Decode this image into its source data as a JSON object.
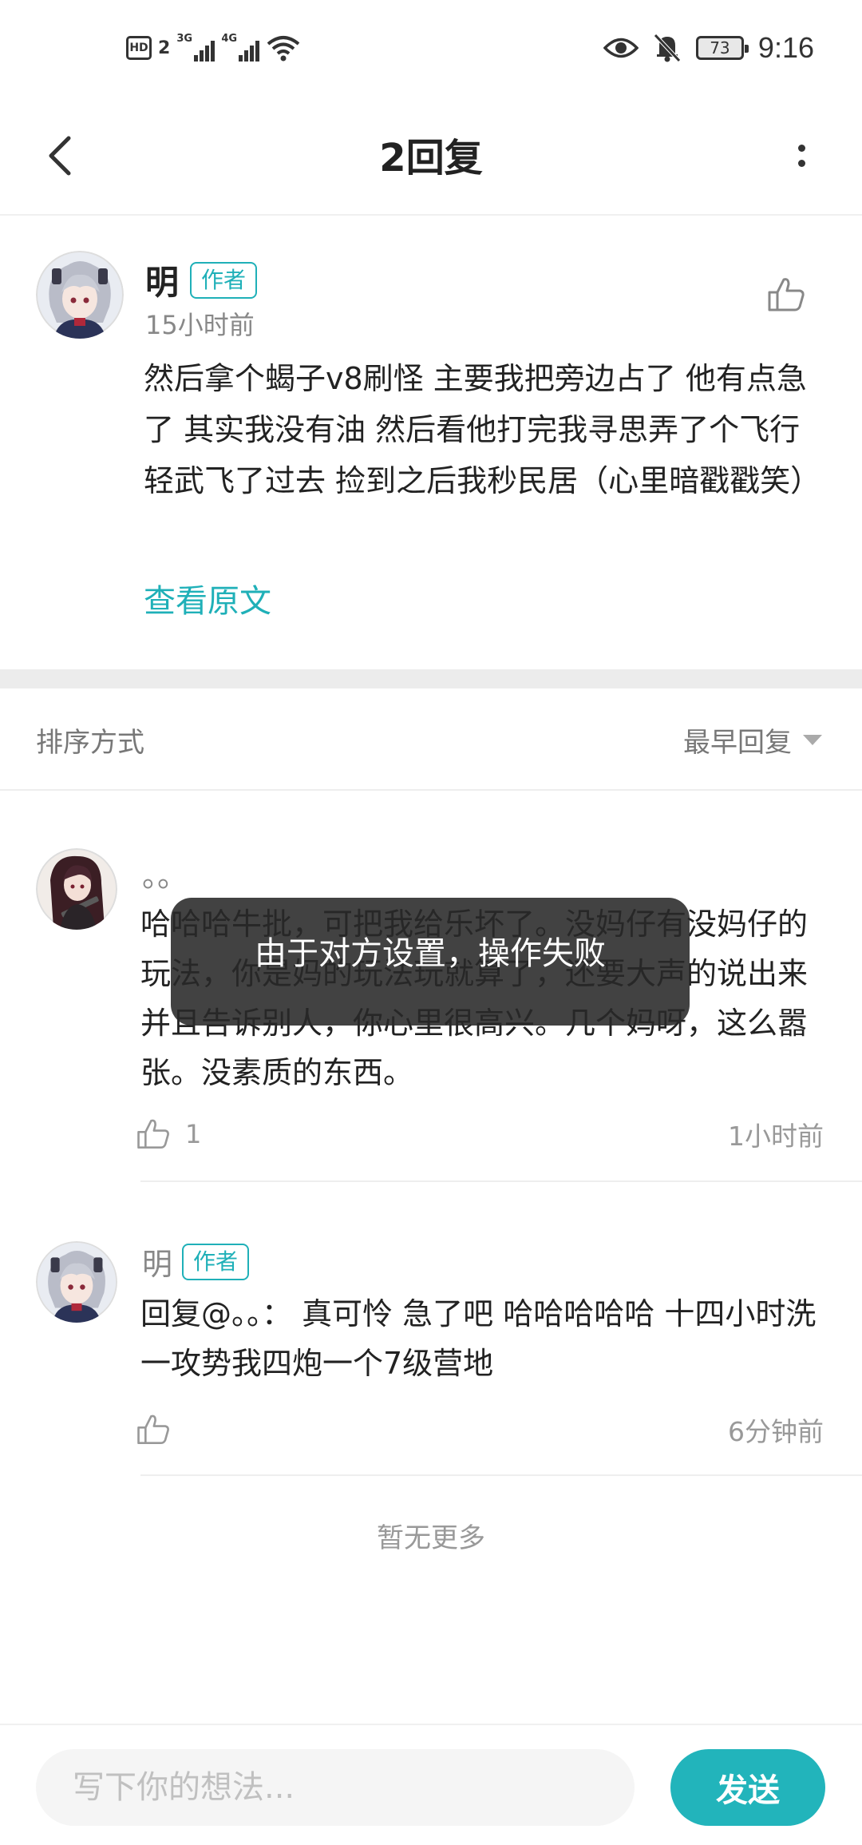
{
  "status_bar": {
    "hd": "HD",
    "sim": "2",
    "net1": "3G",
    "net2": "4G",
    "battery": "73",
    "time": "9:16"
  },
  "header": {
    "title": "2回复"
  },
  "post": {
    "author": "明",
    "badge": "作者",
    "time": "15小时前",
    "body": "然后拿个蝎子v8刷怪  主要我把旁边占了  他有点急了  其实我没有油  然后看他打完我寻思弄了个飞行轻武飞了过去  捡到之后我秒民居（心里暗戳戳笑）",
    "view_original": "查看原文"
  },
  "sort": {
    "label": "排序方式",
    "selected": "最早回复"
  },
  "replies": [
    {
      "name": "。。",
      "body": "哈哈哈牛批，可把我给乐坏了。没妈仔有没妈仔的玩法，你是妈的玩法玩就算了，还要大声的说出来并且告诉别人，你心里很高兴。几个妈呀，这么嚣张。没素质的东西。",
      "likes": "1",
      "time": "1小时前"
    },
    {
      "name": "明",
      "badge": "作者",
      "body": "回复@。。：  真可怜  急了吧  哈哈哈哈哈 十四小时洗一攻势我四炮一个7级营地",
      "likes": "",
      "time": "6分钟前"
    }
  ],
  "no_more": "暂无更多",
  "toast": "由于对方设置，操作失败",
  "composer": {
    "placeholder": "写下你的想法...",
    "send": "发送"
  },
  "colors": {
    "accent": "#1fb0b8",
    "send_bg": "#22b4bb"
  }
}
